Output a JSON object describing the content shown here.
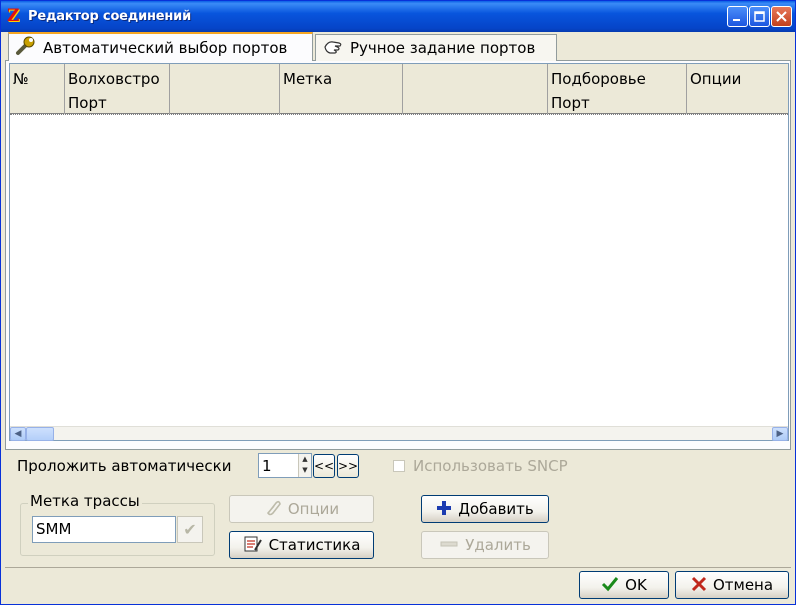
{
  "window": {
    "title": "Редактор соединений",
    "app_icon": "Z"
  },
  "tabs": [
    {
      "label": "Автоматический выбор портов",
      "icon": "wrench-icon",
      "active": true
    },
    {
      "label": "Ручное задание портов",
      "icon": "hand-icon",
      "active": false
    }
  ],
  "table": {
    "columns": [
      {
        "line1": "№",
        "line2": ""
      },
      {
        "line1": "Волховстро",
        "line2": "Порт"
      },
      {
        "line1": "",
        "line2": ""
      },
      {
        "line1": "Метка",
        "line2": ""
      },
      {
        "line1": "",
        "line2": ""
      },
      {
        "line1": "Подборовье",
        "line2": "Порт"
      },
      {
        "line1": "Опции",
        "line2": ""
      }
    ],
    "rows": []
  },
  "auto_route": {
    "label": "Проложить автоматически",
    "value": "1",
    "prev_label": "<<",
    "next_label": ">>",
    "sncp_label": "Использовать SNCP",
    "sncp_checked": false
  },
  "trace_label": {
    "title": "Метка трассы",
    "value": "SMM"
  },
  "buttons": {
    "options": "Опции",
    "statistics": "Статистика",
    "add": "Добавить",
    "delete": "Удалить",
    "ok": "OK",
    "cancel": "Отмена"
  },
  "colors": {
    "titlebar": "#0855dd",
    "face": "#ece9d8",
    "accent_tab": "#f5a623"
  }
}
